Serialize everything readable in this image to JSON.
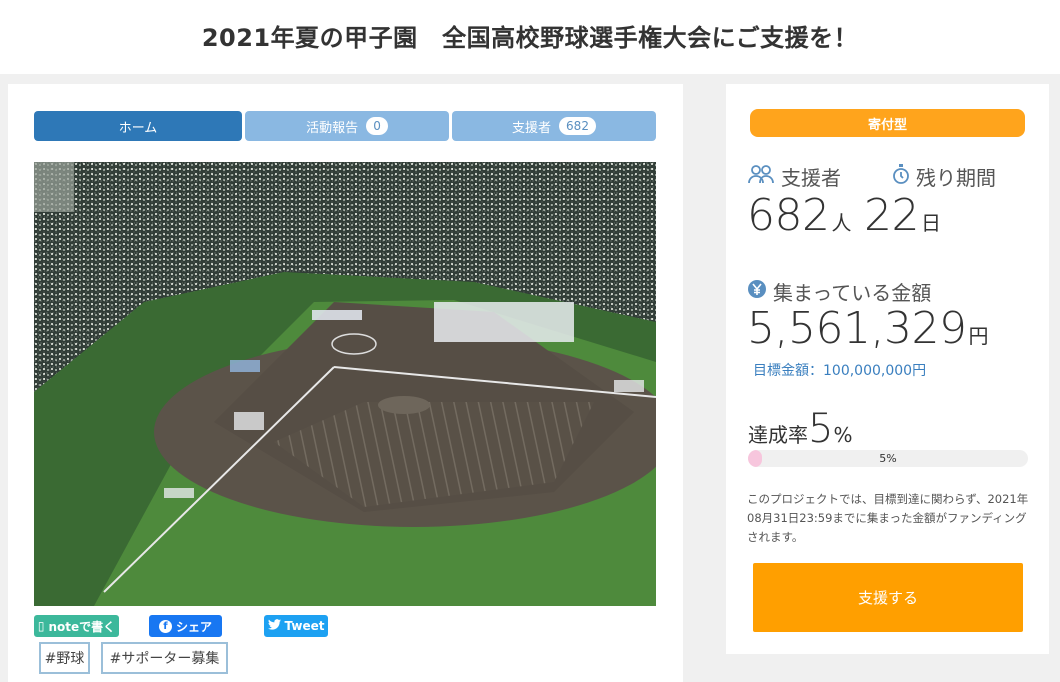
{
  "page": {
    "title": "2021年夏の甲子園　全国高校野球選手権大会にご支援を！"
  },
  "tabs": [
    {
      "label": "ホーム",
      "count": ""
    },
    {
      "label": "活動報告",
      "count": "0"
    },
    {
      "label": "支援者",
      "count": "682"
    }
  ],
  "share": {
    "note": "noteで書く",
    "facebook": "シェア",
    "twitter": "Tweet"
  },
  "tags": [
    "#野球",
    "#サポーター募集"
  ],
  "side": {
    "type_badge": "寄付型",
    "supporters_label": "支援者",
    "supporters_value": "682",
    "supporters_unit": "人",
    "remaining_label": "残り期間",
    "remaining_value": "22",
    "remaining_unit": "日",
    "amount_label": "集まっている金額",
    "amount_value": "5,561,329",
    "amount_unit": "円",
    "target_text": "目標金額：100,000,000円",
    "rate_label": "達成率",
    "rate_value": "5",
    "rate_unit": "%",
    "progress_text": "5%",
    "progress_fraction": 0.05,
    "note": "このプロジェクトでは、目標到達に関わらず、2021年08月31日23:59までに集まった金額がファンディングされます。",
    "support_button": "支援する"
  },
  "icons": {
    "supporters": "people-icon",
    "remaining": "stopwatch-icon",
    "amount": "yen-coin-icon",
    "note": "note-icon",
    "facebook": "facebook-icon",
    "twitter": "twitter-icon"
  },
  "colors": {
    "tab_active": "#2e78b7",
    "tab_inactive": "#8ab8e2",
    "accent_orange": "#ff9f00",
    "badge_orange": "#ffa41c",
    "link_blue": "#3a7fbf",
    "progress_fill": "#f7c6dd"
  }
}
